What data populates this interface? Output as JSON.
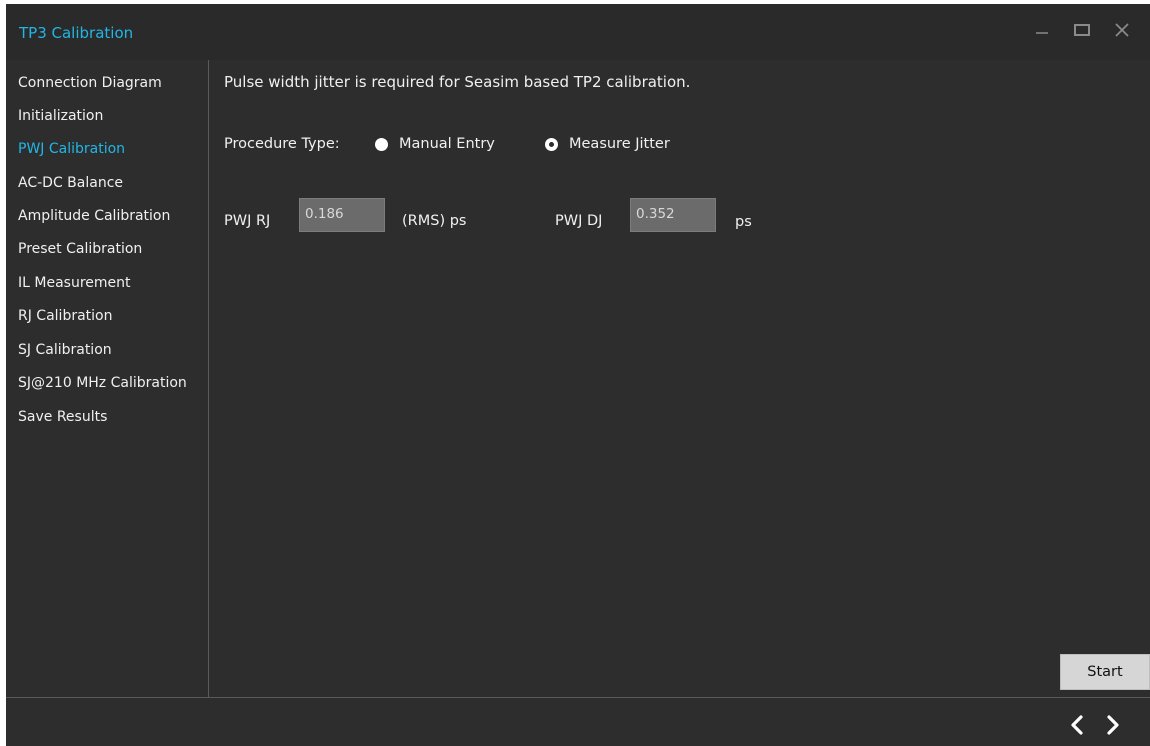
{
  "window": {
    "title": "TP3 Calibration"
  },
  "sidebar": {
    "items": [
      {
        "label": "Connection Diagram",
        "active": false
      },
      {
        "label": "Initialization",
        "active": false
      },
      {
        "label": "PWJ Calibration",
        "active": true
      },
      {
        "label": "AC-DC Balance",
        "active": false
      },
      {
        "label": "Amplitude Calibration",
        "active": false
      },
      {
        "label": "Preset Calibration",
        "active": false
      },
      {
        "label": "IL Measurement",
        "active": false
      },
      {
        "label": "RJ Calibration",
        "active": false
      },
      {
        "label": "SJ Calibration",
        "active": false
      },
      {
        "label": "SJ@210 MHz Calibration",
        "active": false
      },
      {
        "label": "Save Results",
        "active": false
      }
    ]
  },
  "main": {
    "description": "Pulse width jitter is required for Seasim based TP2 calibration.",
    "procedure_type_label": "Procedure Type:",
    "options": [
      {
        "label": "Manual Entry",
        "selected": false
      },
      {
        "label": "Measure Jitter",
        "selected": true
      }
    ],
    "pwj_rj": {
      "label": "PWJ RJ",
      "value": "0.186",
      "unit": "(RMS) ps"
    },
    "pwj_dj": {
      "label": "PWJ DJ",
      "value": "0.352",
      "unit": "ps"
    },
    "start_label": "Start"
  },
  "colors": {
    "accent": "#21b6e6",
    "background": "#2d2d2d",
    "text": "#f0f0f0",
    "field_bg": "#6b6b6b",
    "button_bg": "#d6d6d6"
  },
  "icons": {
    "minimize": "minimize-icon",
    "maximize": "maximize-icon",
    "close": "close-icon",
    "prev": "chevron-left-icon",
    "next": "chevron-right-icon"
  }
}
